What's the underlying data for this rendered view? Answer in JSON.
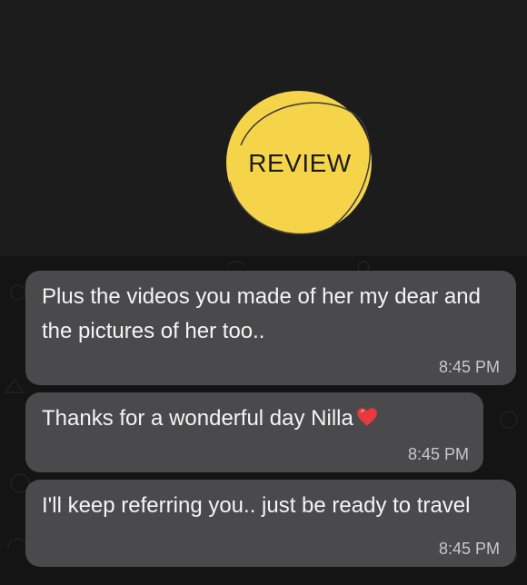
{
  "logo": {
    "text": "REVIEW",
    "color": "#f6d44a"
  },
  "messages": [
    {
      "text": "Plus the videos you made of her my dear and the pictures of her too..",
      "time": "8:45 PM"
    },
    {
      "text": "Thanks for a wonderful day Nilla",
      "emoji": "red-heart",
      "time": "8:45 PM"
    },
    {
      "text": "I'll keep referring you.. just be ready to travel",
      "time": "8:45 PM"
    }
  ],
  "colors": {
    "background": "#1c1c1c",
    "chat_background": "#141414",
    "bubble": "#4a4a4c",
    "heart": "#e8393f"
  }
}
